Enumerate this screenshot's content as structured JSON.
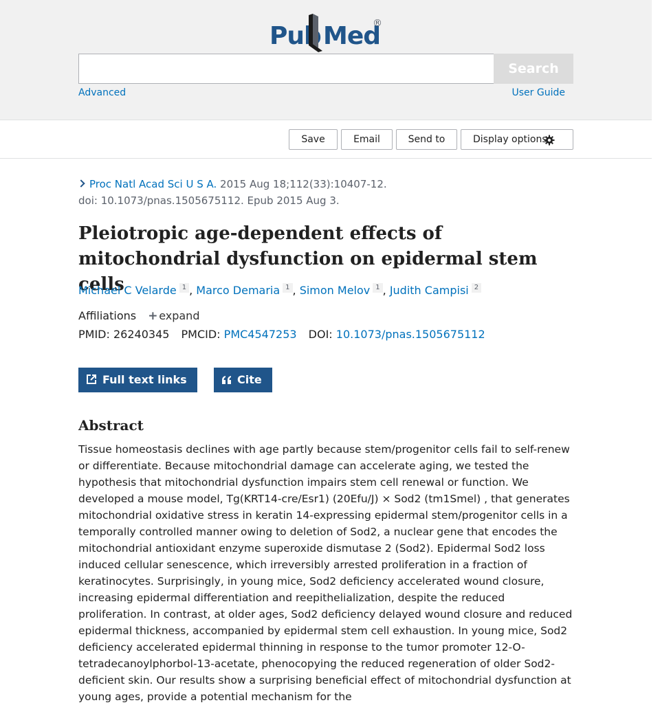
{
  "header": {
    "logo": {
      "pub": "Pub",
      "med": "Med",
      "registered": "®"
    },
    "search": {
      "value": "",
      "placeholder": "",
      "button_label": "Search"
    },
    "advanced_link": "Advanced",
    "user_guide_link": "User Guide"
  },
  "toolbar": {
    "save": "Save",
    "email": "Email",
    "send_to": "Send to",
    "display_options": "Display options"
  },
  "article": {
    "journal": "Proc Natl Acad Sci U S A.",
    "citation_line1": " 2015 Aug 18;112(33):10407-12.",
    "citation_line2": "doi: 10.1073/pnas.1505675112. Epub 2015 Aug 3.",
    "title": "Pleiotropic age-dependent effects of mitochondrial dysfunction on epidermal stem cells",
    "authors": [
      {
        "name": "Michael C Velarde",
        "aff": "1"
      },
      {
        "name": "Marco Demaria",
        "aff": "1"
      },
      {
        "name": "Simon Melov",
        "aff": "1"
      },
      {
        "name": "Judith Campisi",
        "aff": "2"
      }
    ],
    "affiliations_label": "Affiliations",
    "expand_label": "expand",
    "pmid_label": "PMID:",
    "pmid": "26240345",
    "pmcid_label": "PMCID:",
    "pmcid": "PMC4547253",
    "doi_label": "DOI:",
    "doi": "10.1073/pnas.1505675112"
  },
  "buttons": {
    "full_text": "Full text links",
    "cite": "Cite"
  },
  "abstract": {
    "heading": "Abstract",
    "text": "Tissue homeostasis declines with age partly because stem/progenitor cells fail to self-renew or differentiate. Because mitochondrial damage can accelerate aging, we tested the hypothesis that mitochondrial dysfunction impairs stem cell renewal or function. We developed a mouse model, Tg(KRT14-cre/Esr1) (20Efu/J) × Sod2 (tm1Smel) , that generates mitochondrial oxidative stress in keratin 14-expressing epidermal stem/progenitor cells in a temporally controlled manner owing to deletion of Sod2, a nuclear gene that encodes the mitochondrial antioxidant enzyme superoxide dismutase 2 (Sod2). Epidermal Sod2 loss induced cellular senescence, which irreversibly arrested proliferation in a fraction of keratinocytes. Surprisingly, in young mice, Sod2 deficiency accelerated wound closure, increasing epidermal differentiation and reepithelialization, despite the reduced proliferation. In contrast, at older ages, Sod2 deficiency delayed wound closure and reduced epidermal thickness, accompanied by epidermal stem cell exhaustion. In young mice, Sod2 deficiency accelerated epidermal thinning in response to the tumor promoter 12-O-tetradecanoylphorbol-13-acetate, phenocopying the reduced regeneration of older Sod2-deficient skin. Our results show a surprising beneficial effect of mitochondrial dysfunction at young ages, provide a potential mechanism for the"
  },
  "colors": {
    "brand": "#20558a",
    "link": "#0071bc",
    "header_bg": "#f1f1f1"
  }
}
